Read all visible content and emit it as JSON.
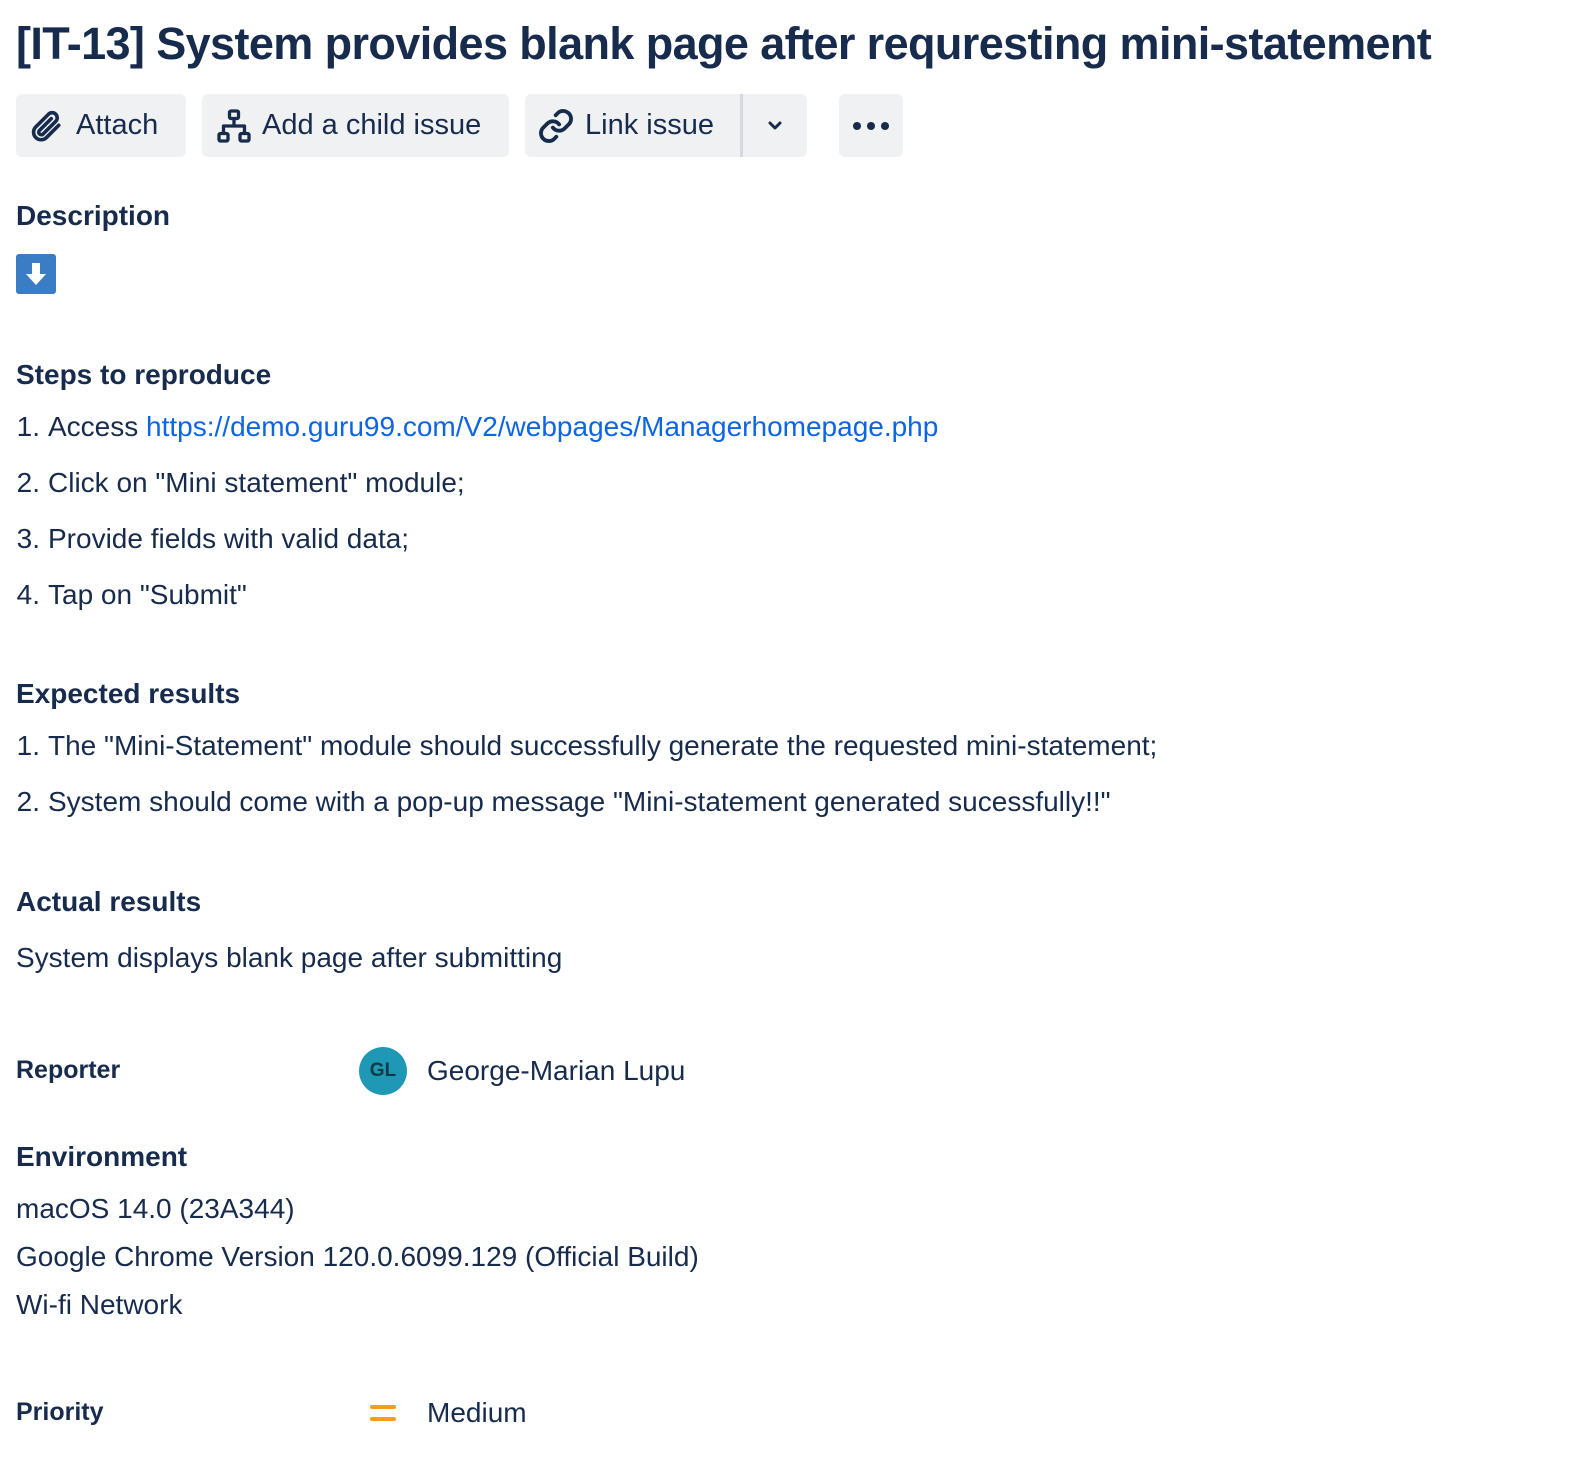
{
  "issue": {
    "title": "[IT-13] System provides blank page after requresting mini-statement"
  },
  "toolbar": {
    "attach_label": "Attach",
    "child_label": "Add a child issue",
    "link_label": "Link issue"
  },
  "description": {
    "label": "Description"
  },
  "steps": {
    "heading": "Steps to reproduce",
    "items": [
      {
        "num": "1.",
        "prefix": "Access ",
        "link": "https://demo.guru99.com/V2/webpages/Managerhomepage.php"
      },
      {
        "num": "2.",
        "text": "Click on \"Mini statement\" module;"
      },
      {
        "num": "3.",
        "text": "Provide fields with valid data;"
      },
      {
        "num": "4.",
        "text": "Tap on \"Submit\""
      }
    ]
  },
  "expected": {
    "heading": "Expected results",
    "items": [
      {
        "num": "1.",
        "text": "The \"Mini-Statement\" module should successfully generate the requested mini-statement;"
      },
      {
        "num": "2.",
        "text": "System should come with a pop-up message \"Mini-statement generated sucessfully!!\""
      }
    ]
  },
  "actual": {
    "heading": "Actual results",
    "text": "System displays blank page after submitting"
  },
  "reporter": {
    "label": "Reporter",
    "initials": "GL",
    "name": "George-Marian Lupu",
    "avatar_color": "#1f98b5"
  },
  "environment": {
    "heading": "Environment",
    "lines": [
      "macOS 14.0 (23A344)",
      "Google Chrome Version 120.0.6099.129 (Official Build)",
      "Wi-fi Network"
    ]
  },
  "priority": {
    "label": "Priority",
    "value": "Medium",
    "icon": "priority-medium-icon",
    "icon_color": "#ff991f"
  },
  "colors": {
    "text": "#172b4d",
    "link": "#0c66e4",
    "button_bg": "#f0f1f3",
    "download_icon_bg": "#3b7dc4"
  }
}
